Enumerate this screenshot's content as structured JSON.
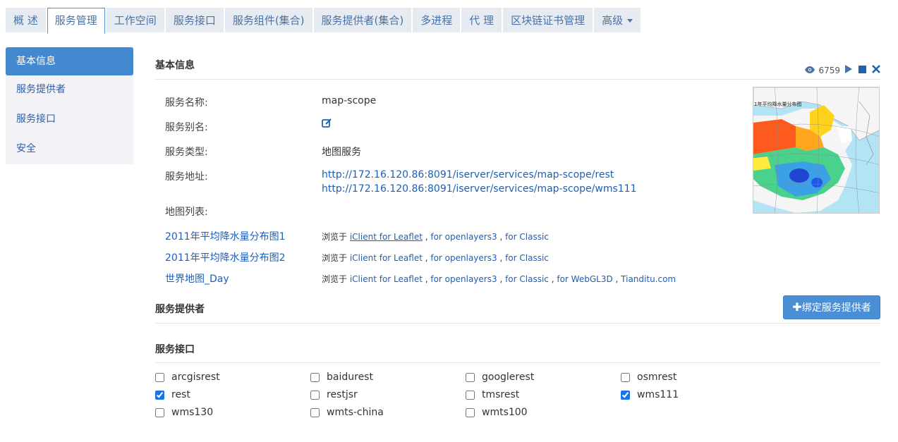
{
  "tabs": [
    {
      "label": "概 述"
    },
    {
      "label": "服务管理",
      "active": true
    },
    {
      "label": "工作空间"
    },
    {
      "label": "服务接口"
    },
    {
      "label": "服务组件(集合)"
    },
    {
      "label": "服务提供者(集合)"
    },
    {
      "label": "多进程"
    },
    {
      "label": "代 理"
    },
    {
      "label": "区块链证书管理"
    },
    {
      "label": "高级"
    }
  ],
  "sidebar": {
    "items": [
      {
        "label": "基本信息",
        "active": true
      },
      {
        "label": "服务提供者"
      },
      {
        "label": "服务接口"
      },
      {
        "label": "安全"
      }
    ]
  },
  "basic": {
    "title": "基本信息",
    "view_count": "6759",
    "name_label": "服务名称:",
    "name_value": "map-scope",
    "alias_label": "服务别名:",
    "type_label": "服务类型:",
    "type_value": "地图服务",
    "address_label": "服务地址:",
    "address_1": "http://172.16.120.86:8091/iserver/services/map-scope/rest",
    "address_2": "http://172.16.120.86:8091/iserver/services/map-scope/wms111",
    "maplist_label": "地图列表:",
    "thumb_caption": "1年平均降水量分布图"
  },
  "maps": [
    {
      "name": "2011年平均降水量分布图1",
      "browse_prefix": "浏览于",
      "clients": [
        "iClient for Leaflet",
        "for openlayers3",
        "for Classic"
      ]
    },
    {
      "name": "2011年平均降水量分布图2",
      "browse_prefix": "浏览于",
      "clients": [
        "iClient for Leaflet",
        "for openlayers3",
        "for Classic"
      ]
    },
    {
      "name": "世界地图_Day",
      "browse_prefix": "浏览于",
      "clients": [
        "iClient for Leaflet",
        "for openlayers3",
        "for Classic",
        "for WebGL3D",
        "Tianditu.com"
      ]
    }
  ],
  "providers": {
    "title": "服务提供者",
    "bind_button": "绑定服务提供者"
  },
  "interfaces": {
    "title": "服务接口",
    "rows": [
      [
        {
          "label": "arcgisrest",
          "checked": false
        },
        {
          "label": "baidurest",
          "checked": false
        },
        {
          "label": "googlerest",
          "checked": false
        },
        {
          "label": "osmrest",
          "checked": false
        }
      ],
      [
        {
          "label": "rest",
          "checked": true
        },
        {
          "label": "restjsr",
          "checked": false
        },
        {
          "label": "tmsrest",
          "checked": false
        },
        {
          "label": "wms111",
          "checked": true
        }
      ],
      [
        {
          "label": "wms130",
          "checked": false
        },
        {
          "label": "wmts-china",
          "checked": false
        },
        {
          "label": "wmts100",
          "checked": false
        }
      ]
    ]
  },
  "colors": {
    "accent": "#4289d0",
    "link": "#1d5fb8",
    "tab_bg": "#e6ebf2",
    "sidebar_bg": "#f2f2f7"
  }
}
